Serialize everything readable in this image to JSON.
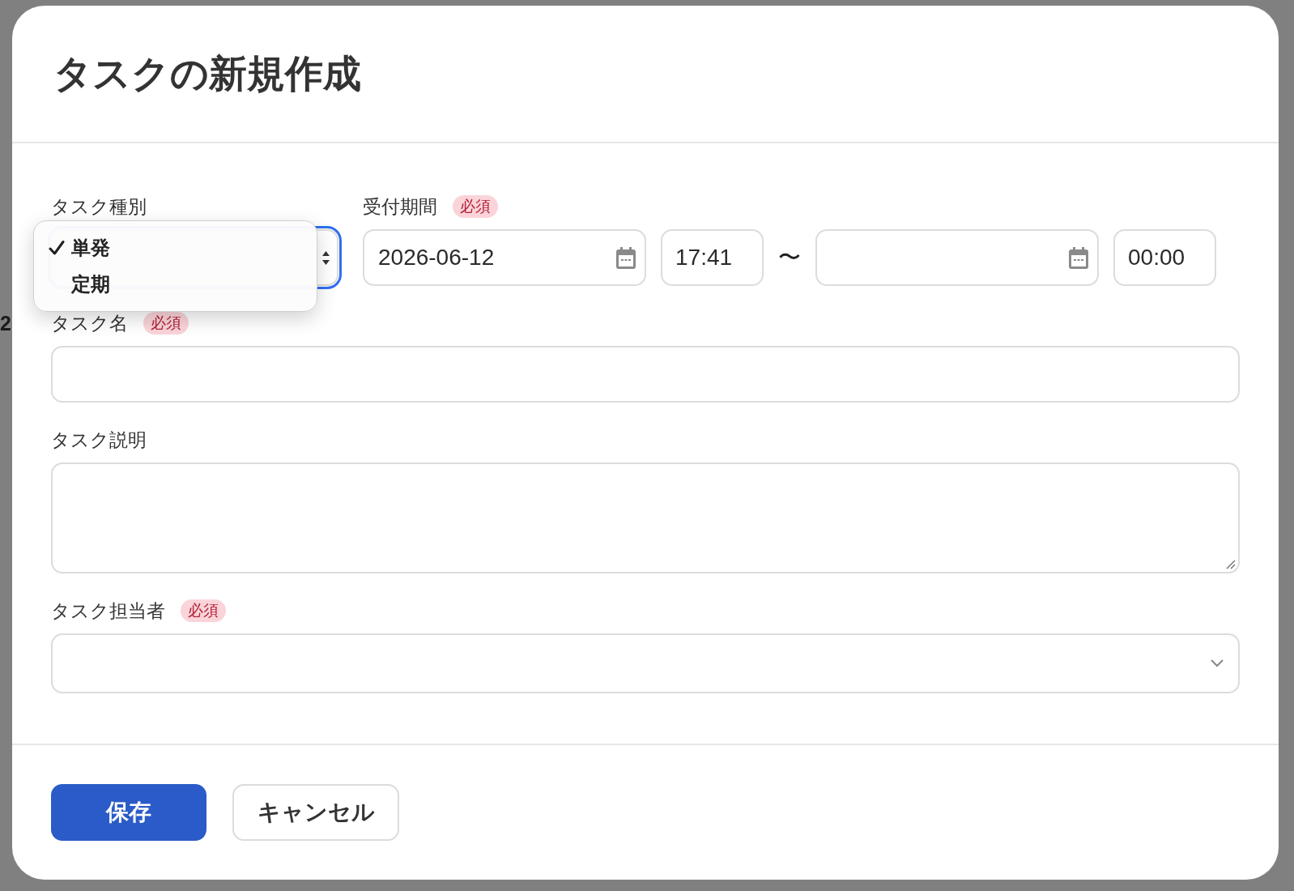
{
  "background": {
    "fragment": "2"
  },
  "dialog": {
    "title": "タスクの新規作成",
    "task_type": {
      "label": "タスク種別",
      "focused": true,
      "menu_open": true,
      "options": [
        {
          "label": "単発",
          "selected": true
        },
        {
          "label": "定期",
          "selected": false
        }
      ]
    },
    "period": {
      "label": "受付期間",
      "badge": "必須",
      "inputs": [
        {
          "kind": "date",
          "value": "2026-06-12"
        },
        {
          "kind": "time",
          "value": "17:41"
        },
        {
          "kind": "separator",
          "text": "〜"
        },
        {
          "kind": "date"
        },
        {
          "kind": "time",
          "value": "00:00"
        }
      ]
    },
    "fields": [
      {
        "kind": "text",
        "label": "タスク名",
        "badge": "必須"
      },
      {
        "kind": "textarea",
        "label": "タスク説明"
      },
      {
        "kind": "select",
        "label": "タスク担当者",
        "badge": "必須"
      }
    ],
    "buttons": [
      {
        "kind": "primary",
        "label": "保存"
      },
      {
        "kind": "secondary",
        "label": "キャンセル"
      }
    ]
  }
}
